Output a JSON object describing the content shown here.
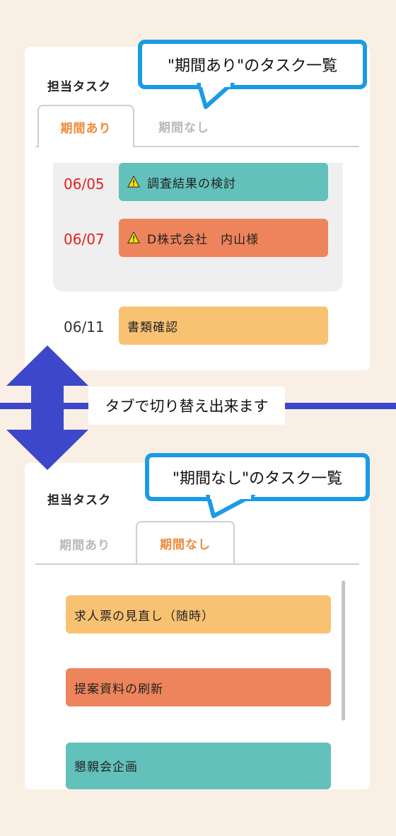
{
  "panel1": {
    "title": "担当タスク",
    "tabs": [
      "期間あり",
      "期間なし"
    ],
    "overdue_tasks": [
      {
        "date": "06/05",
        "label": "調査結果の検討",
        "color": "#63c1bc",
        "icon": "warning-icon"
      },
      {
        "date": "06/07",
        "label": "D株式会社　内山様",
        "color": "#ee845b",
        "icon": "warning-icon"
      }
    ],
    "upcoming_tasks": [
      {
        "date": "06/11",
        "label": "書類確認",
        "color": "#f8c272"
      }
    ]
  },
  "callout1": "\"期間あり\"のタスク一覧",
  "banner": "タブで切り替え出来ます",
  "panel2": {
    "title": "担当タスク",
    "tabs": [
      "期間あり",
      "期間なし"
    ],
    "tasks": [
      {
        "label": "求人票の見直し（随時）",
        "color": "#f8c272"
      },
      {
        "label": "提案資料の刷新",
        "color": "#ee845b"
      },
      {
        "label": "懇親会企画",
        "color": "#63c1bc"
      }
    ]
  },
  "callout2": "\"期間なし\"のタスク一覧",
  "colors": {
    "background": "#f9efe5",
    "active_tab": "#ef8a38",
    "overdue_date": "#e02020",
    "callout_border": "#1a9be6",
    "arrow": "#3d47c9"
  }
}
